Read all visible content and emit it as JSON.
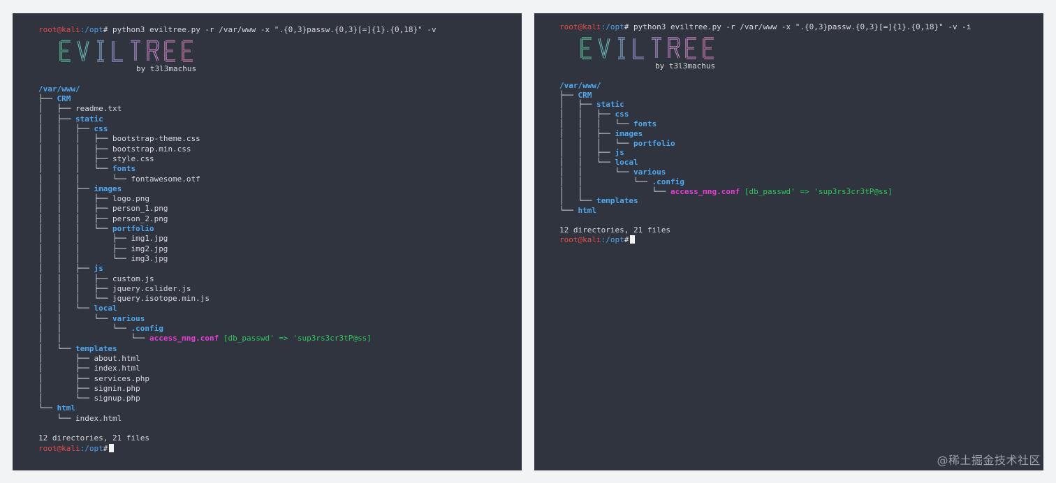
{
  "colors": {
    "background": "#f2f3f5",
    "terminal_bg": "#2f343e",
    "prompt_red": "#e44b4b",
    "directory_blue": "#4fa8f0",
    "match_magenta": "#e43fd4",
    "match_green": "#2ec95a",
    "text": "#d7d9de"
  },
  "prompt": {
    "user_host": "root@kali",
    "path": ":/opt",
    "symbol": "#"
  },
  "banner": {
    "title": "EVILTREE",
    "byline": "by t3l3machus"
  },
  "left": {
    "command": " python3 eviltree.py -r /var/www -x \".{0,3}passw.{0,3}[=]{1}.{0,18}\" -v",
    "root": "/var/www/",
    "tree": [
      {
        "prefix": "├── ",
        "name": "CRM",
        "type": "dir"
      },
      {
        "prefix": "│   ├── ",
        "name": "readme.txt",
        "type": "file"
      },
      {
        "prefix": "│   ├── ",
        "name": "static",
        "type": "dir"
      },
      {
        "prefix": "│   │   ├── ",
        "name": "css",
        "type": "dir"
      },
      {
        "prefix": "│   │   │   ├── ",
        "name": "bootstrap-theme.css",
        "type": "file"
      },
      {
        "prefix": "│   │   │   ├── ",
        "name": "bootstrap.min.css",
        "type": "file"
      },
      {
        "prefix": "│   │   │   ├── ",
        "name": "style.css",
        "type": "file"
      },
      {
        "prefix": "│   │   │   └── ",
        "name": "fonts",
        "type": "dir"
      },
      {
        "prefix": "│   │   │       └── ",
        "name": "fontawesome.otf",
        "type": "file"
      },
      {
        "prefix": "│   │   ├── ",
        "name": "images",
        "type": "dir"
      },
      {
        "prefix": "│   │   │   ├── ",
        "name": "logo.png",
        "type": "file"
      },
      {
        "prefix": "│   │   │   ├── ",
        "name": "person_1.png",
        "type": "file"
      },
      {
        "prefix": "│   │   │   ├── ",
        "name": "person_2.png",
        "type": "file"
      },
      {
        "prefix": "│   │   │   └── ",
        "name": "portfolio",
        "type": "dir"
      },
      {
        "prefix": "│   │   │       ├── ",
        "name": "img1.jpg",
        "type": "file"
      },
      {
        "prefix": "│   │   │       ├── ",
        "name": "img2.jpg",
        "type": "file"
      },
      {
        "prefix": "│   │   │       └── ",
        "name": "img3.jpg",
        "type": "file"
      },
      {
        "prefix": "│   │   ├── ",
        "name": "js",
        "type": "dir"
      },
      {
        "prefix": "│   │   │   ├── ",
        "name": "custom.js",
        "type": "file"
      },
      {
        "prefix": "│   │   │   ├── ",
        "name": "jquery.cslider.js",
        "type": "file"
      },
      {
        "prefix": "│   │   │   └── ",
        "name": "jquery.isotope.min.js",
        "type": "file"
      },
      {
        "prefix": "│   │   └── ",
        "name": "local",
        "type": "dir"
      },
      {
        "prefix": "│   │       └── ",
        "name": "various",
        "type": "dir"
      },
      {
        "prefix": "│   │           └── ",
        "name": ".config",
        "type": "dir"
      },
      {
        "prefix": "│   │               └── ",
        "name": "access_mng.conf",
        "type": "match",
        "match": " [db_passwd' => 'sup3rs3cr3tP@ss]"
      },
      {
        "prefix": "│   └── ",
        "name": "templates",
        "type": "dir"
      },
      {
        "prefix": "│       ├── ",
        "name": "about.html",
        "type": "file"
      },
      {
        "prefix": "│       ├── ",
        "name": "index.html",
        "type": "file"
      },
      {
        "prefix": "│       ├── ",
        "name": "services.php",
        "type": "file"
      },
      {
        "prefix": "│       ├── ",
        "name": "signin.php",
        "type": "file"
      },
      {
        "prefix": "│       └── ",
        "name": "signup.php",
        "type": "file"
      },
      {
        "prefix": "└── ",
        "name": "html",
        "type": "dir"
      },
      {
        "prefix": "    └── ",
        "name": "index.html",
        "type": "file"
      }
    ],
    "summary": "12 directories, 21 files"
  },
  "right": {
    "command": " python3 eviltree.py -r /var/www -x \".{0,3}passw.{0,3}[=]{1}.{0,18}\" -v -i",
    "root": "/var/www/",
    "tree": [
      {
        "prefix": "├── ",
        "name": "CRM",
        "type": "dir"
      },
      {
        "prefix": "│   ├── ",
        "name": "static",
        "type": "dir"
      },
      {
        "prefix": "│   │   ├── ",
        "name": "css",
        "type": "dir"
      },
      {
        "prefix": "│   │   │   └── ",
        "name": "fonts",
        "type": "dir"
      },
      {
        "prefix": "│   │   ├── ",
        "name": "images",
        "type": "dir"
      },
      {
        "prefix": "│   │   │   └── ",
        "name": "portfolio",
        "type": "dir"
      },
      {
        "prefix": "│   │   ├── ",
        "name": "js",
        "type": "dir"
      },
      {
        "prefix": "│   │   └── ",
        "name": "local",
        "type": "dir"
      },
      {
        "prefix": "│   │       └── ",
        "name": "various",
        "type": "dir"
      },
      {
        "prefix": "│   │           └── ",
        "name": ".config",
        "type": "dir"
      },
      {
        "prefix": "│   │               └── ",
        "name": "access_mng.conf",
        "type": "match",
        "match": " [db_passwd' => 'sup3rs3cr3tP@ss]"
      },
      {
        "prefix": "│   └── ",
        "name": "templates",
        "type": "dir"
      },
      {
        "prefix": "└── ",
        "name": "html",
        "type": "dir"
      }
    ],
    "summary": "12 directories, 21 files"
  },
  "watermark": "@稀土掘金技术社区"
}
